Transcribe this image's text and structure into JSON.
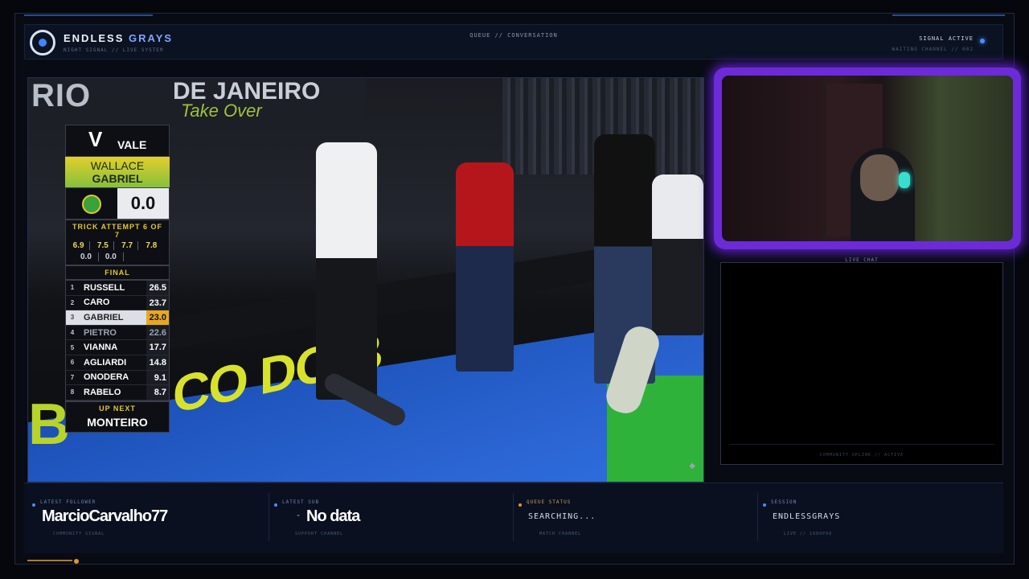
{
  "header": {
    "brand_part1": "ENDLESS",
    "brand_part2": "GRAYS",
    "tagline": "NIGHT SIGNAL // LIVE SYSTEM",
    "center": "QUEUE // CONVERSATION",
    "signal": "SIGNAL ACTIVE",
    "waiting": "WAITING CHANNEL // 002"
  },
  "video": {
    "banner_left": "RIO",
    "banner_city": "DE JANEIRO",
    "banner_script": "Take Over",
    "wall_text": "CO DO B",
    "wall_letter": "B",
    "scoreboard": {
      "sponsor": "VALE",
      "sponsor_mark": "V",
      "athlete_first": "WALLACE",
      "athlete_last": "GABRIEL",
      "score": "0.0",
      "trick_label": "TRICK ATTEMPT 6 OF 7",
      "tricks_row1": [
        "6.9",
        "7.5",
        "7.7",
        "7.8"
      ],
      "tricks_row2": [
        "0.0",
        "0.0"
      ],
      "final_label": "FINAL",
      "standings": [
        {
          "rank": "1",
          "name": "RUSSELL",
          "score": "26.5"
        },
        {
          "rank": "2",
          "name": "CARO",
          "score": "23.7"
        },
        {
          "rank": "3",
          "name": "GABRIEL",
          "score": "23.0"
        },
        {
          "rank": "4",
          "name": "PIETRO",
          "score": "22.6"
        },
        {
          "rank": "5",
          "name": "VIANNA",
          "score": "17.7"
        },
        {
          "rank": "6",
          "name": "AGLIARDI",
          "score": "14.8"
        },
        {
          "rank": "7",
          "name": "ONODERA",
          "score": "9.1"
        },
        {
          "rank": "8",
          "name": "RABELO",
          "score": "8.7"
        }
      ],
      "up_next_label": "UP NEXT",
      "up_next_name": "MONTEIRO"
    }
  },
  "chat": {
    "title": "LIVE CHAT",
    "footer": "COMMUNITY UPLINK // ACTIVE"
  },
  "bottom": {
    "follower_label": "LATEST FOLLOWER",
    "follower_value": "MarcioCarvalho77",
    "follower_sub": "COMMUNITY SIGNAL",
    "sub_label": "LATEST SUB",
    "sub_dash": "-",
    "sub_value": "No data",
    "sub_sub": "SUPPORT CHANNEL",
    "queue_label": "QUEUE STATUS",
    "queue_value": "SEARCHING...",
    "queue_sub": "MATCH CHANNEL",
    "session_label": "SESSION",
    "session_value": "ENDLESSGRAYS",
    "session_sub": "LIVE // 1080P60"
  },
  "colors": {
    "accent_blue": "#4b8dff",
    "cam_glow": "#6c2bd6",
    "highlight_score": "#e8a820",
    "queue_dot": "#e0952f"
  }
}
